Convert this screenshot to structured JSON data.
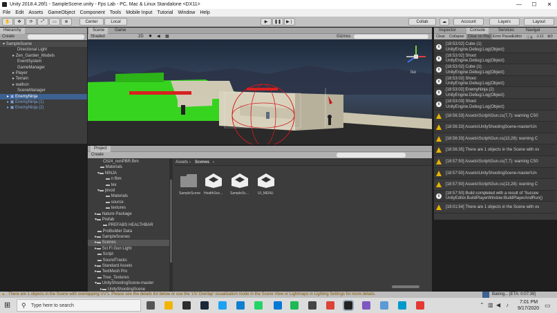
{
  "window": {
    "title": "Unity 2018.4.26f1 - SampleScene.unity - Fps Lab - PC, Mac & Linux Standalone <DX11>",
    "min": "—",
    "max": "☐",
    "close": "✕"
  },
  "menu": [
    "File",
    "Edit",
    "Assets",
    "GameObject",
    "Component",
    "Tools",
    "Mobile Input",
    "Tutorial",
    "Window",
    "Help"
  ],
  "toolbar": {
    "center": "Center",
    "local": "Local",
    "collab": "Collab",
    "account": "Account",
    "layers": "Layers",
    "layout": "Layout"
  },
  "hierarchy": {
    "tab": "Hierarchy",
    "create": "Create",
    "search_placeholder": "All",
    "scene": "SampleScene",
    "items": [
      "Directional Light",
      "Zen_Garden_Models",
      "EventSystem",
      "GameManager",
      "Player",
      "Terrain",
      "wallrun",
      "SceneManager",
      "EnemyNinja",
      "EnemyNinja (1)",
      "EnemyNinja (2)"
    ]
  },
  "scene": {
    "tab_scene": "Scene",
    "tab_game": "Game",
    "shaded": "Shaded",
    "mode_2d": "2D",
    "gizmos": "Gizmos",
    "search": "All",
    "iso": "Iso"
  },
  "project": {
    "tab": "Project",
    "create": "Create",
    "tree": [
      "Ch24_nonPBR.fbm",
      "Materials",
      "NINJA",
      "n fbm",
      "tex",
      "pisod",
      "Materials",
      "source",
      "textures",
      "Nature Package",
      "Prefab",
      "PREFABS HEALTHBAR",
      "ProBuilder Data",
      "SampleScenes",
      "Scenes",
      "Sci Fi Gun Light",
      "Script",
      "SoundTracks",
      "Standard Assets",
      "TextMesh Pro",
      "Tree_Textures",
      "UnityShootingScene-master",
      "UnityShootingScene"
    ],
    "breadcrumb": [
      "Assets",
      "Scenes"
    ],
    "assets": [
      "SampleScene",
      "HealthSce...",
      "SampleSc...",
      "UI_MENU"
    ]
  },
  "inspector": {
    "tabs": [
      "Inspector",
      "Console",
      "Services",
      "Navigat"
    ],
    "buttons": [
      "Clear",
      "Collapse",
      "Clear on Play",
      "Error Pause",
      "Editor"
    ]
  },
  "console": [
    {
      "kind": "info",
      "t1": "[18:53:02] Cube (1)",
      "t2": "UnityEngine.Debug:Log(Object)"
    },
    {
      "kind": "info",
      "t1": "[18:53:02] Shoot",
      "t2": "UnityEngine.Debug:Log(Object)"
    },
    {
      "kind": "info",
      "t1": "[18:53:02] Cube (1)",
      "t2": "UnityEngine.Debug:Log(Object)"
    },
    {
      "kind": "info",
      "t1": "[18:53:02] Shoot",
      "t2": "UnityEngine.Debug:Log(Object)"
    },
    {
      "kind": "info",
      "t1": "[18:53:02] EnemyNinja (2)",
      "t2": "UnityEngine.Debug:Log(Object)"
    },
    {
      "kind": "info",
      "t1": "[18:53:03] Shoot",
      "t2": "UnityEngine.Debug:Log(Object)"
    },
    {
      "kind": "warn",
      "t1": "[18:56:33] Assets\\Script\\Gun.cs(7,7): warning CS0",
      "t2": ""
    },
    {
      "kind": "warn",
      "t1": "[18:56:33] Assets\\UnityShootingScene-master\\Un",
      "t2": ""
    },
    {
      "kind": "warn",
      "t1": "[18:56:33] Assets\\Script\\Gun.cs(13,28): warning C",
      "t2": ""
    },
    {
      "kind": "warn",
      "t1": "[18:56:35] There are 1 objects in the Scene with ov",
      "t2": ""
    },
    {
      "kind": "warn",
      "t1": "[18:57:50] Assets\\Script\\Gun.cs(7,7): warning CS0",
      "t2": ""
    },
    {
      "kind": "warn",
      "t1": "[18:57:50] Assets\\UnityShootingScene-master\\Un",
      "t2": ""
    },
    {
      "kind": "warn",
      "t1": "[18:57:50] Assets\\Script\\Gun.cs(13,28): warning C",
      "t2": ""
    },
    {
      "kind": "info",
      "t1": "[18:57:50] Build completed with a result of 'Succee",
      "t2": "UnityEditor.BuildPlayerWindow:BuildPlayerAndRun()"
    },
    {
      "kind": "warn",
      "t1": "[19:01:54] There are 1 objects in the Scene with ov",
      "t2": ""
    }
  ],
  "console_counts": {
    "info": "9",
    "warn": "11",
    "err": "0"
  },
  "status": {
    "message": "There are 1 objects in the Scene with overlapping UV's. Please see the details list below or use the 'UV Overlap' visualisation mode in the Scene View or Lightmaps in Lighting Settings for more details.",
    "baking": "Baking... [ETA: 0:07:39]"
  },
  "taskbar": {
    "search_placeholder": "Type here to search",
    "time": "7:01 PM",
    "date": "9/17/2020"
  },
  "colors": {
    "selection": "#3d6190",
    "toolbar": "#c2c2c2",
    "panel": "#3c3c3c"
  }
}
